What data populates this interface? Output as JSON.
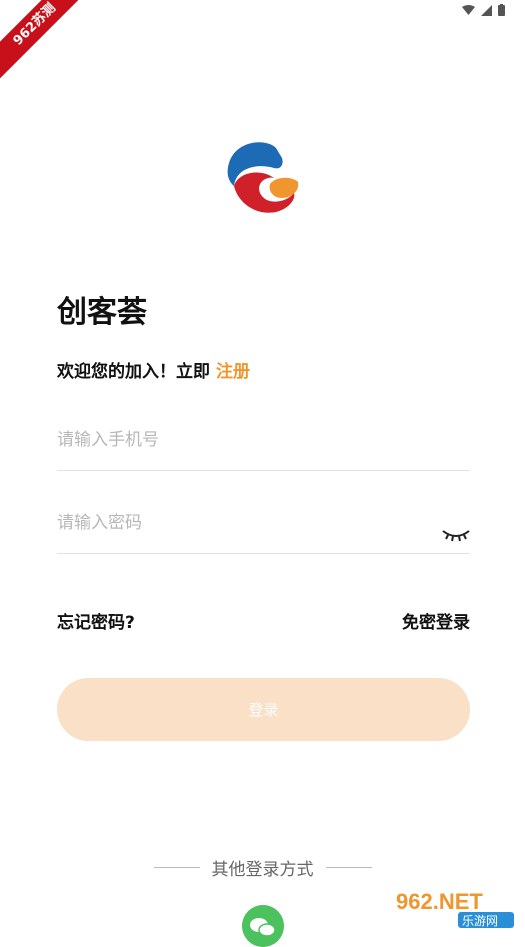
{
  "watermark_ribbon": "962苏测",
  "app": {
    "title": "创客荟"
  },
  "welcome": {
    "text": "欢迎您的加入！立即",
    "register_link": "注册"
  },
  "phone_input": {
    "placeholder": "请输入手机号",
    "value": ""
  },
  "password_input": {
    "placeholder": "请输入密码",
    "value": ""
  },
  "links": {
    "forgot_password": "忘记密码?",
    "sms_login": "免密登录"
  },
  "login_button": {
    "label": "登录"
  },
  "other_login": {
    "label": "其他登录方式",
    "icons": [
      "wechat-icon"
    ]
  },
  "watermark_site": {
    "brand": "962.NET",
    "name": "乐游网"
  },
  "colors": {
    "accent": "#f0962e",
    "button_bg": "#fae0c6",
    "wechat": "#4cc25e"
  }
}
